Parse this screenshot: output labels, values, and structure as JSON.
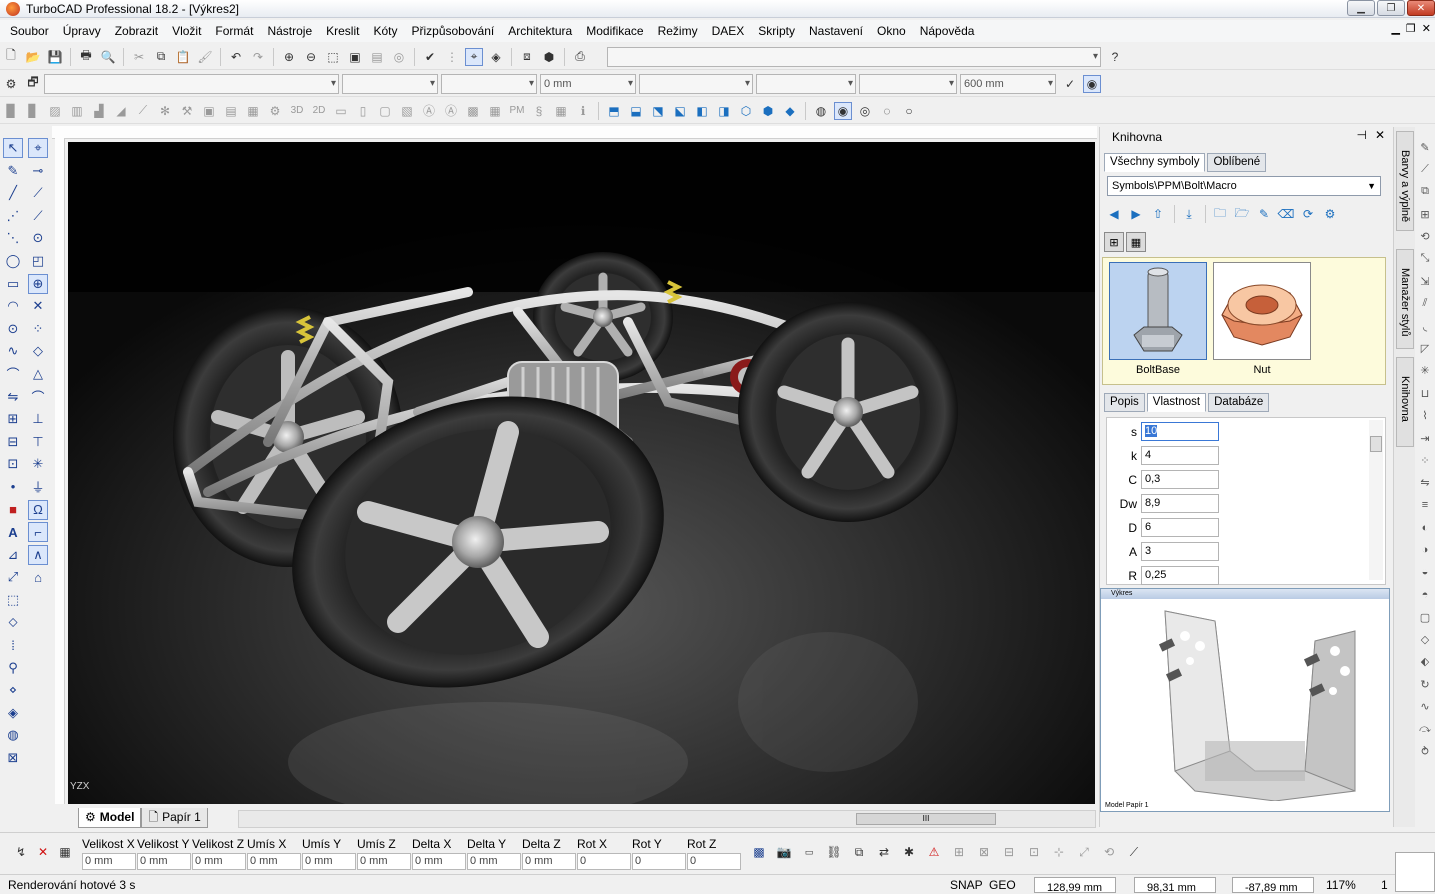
{
  "window": {
    "title": "TurboCAD Professional 18.2 - [Výkres2]"
  },
  "menu": [
    "Soubor",
    "Úpravy",
    "Zobrazit",
    "Vložit",
    "Formát",
    "Nástroje",
    "Kreslit",
    "Kóty",
    "Přizpůsobování",
    "Architektura",
    "Modifikace",
    "Režimy",
    "DAEX",
    "Skripty",
    "Nastavení",
    "Okno",
    "Nápověda"
  ],
  "toolbar2": {
    "width_value": "0 mm",
    "height_value": "600 mm"
  },
  "text3d": [
    "3D",
    "2D",
    "PM"
  ],
  "tabs": {
    "model": "Model",
    "paper": "Papír 1"
  },
  "inspector": {
    "fields": [
      {
        "label": "Velikost X",
        "value": "0 mm"
      },
      {
        "label": "Velikost Y",
        "value": "0 mm"
      },
      {
        "label": "Velikost Z",
        "value": "0 mm"
      },
      {
        "label": "Umís  X",
        "value": "0 mm"
      },
      {
        "label": "Umís Y",
        "value": "0 mm"
      },
      {
        "label": "Umís Z",
        "value": "0 mm"
      },
      {
        "label": "Delta X",
        "value": "0 mm"
      },
      {
        "label": "Delta Y",
        "value": "0 mm"
      },
      {
        "label": "Delta Z",
        "value": "0 mm"
      },
      {
        "label": "Rot X",
        "value": "0"
      },
      {
        "label": "Rot Y",
        "value": "0"
      },
      {
        "label": "Rot Z",
        "value": "0"
      }
    ]
  },
  "status": {
    "message": "Renderování hotové 3 s",
    "snap": "SNAP",
    "geo": "GEO",
    "x": "128,99 mm",
    "y": "98,31 mm",
    "z": "-87,89 mm",
    "zoom": "117%",
    "page": "1"
  },
  "library": {
    "title": "Knihovna",
    "tabs": [
      "Všechny symboly",
      "Oblíbené"
    ],
    "path": "Symbols\\PPM\\Bolt\\Macro",
    "items": [
      {
        "name": "BoltBase",
        "selected": true
      },
      {
        "name": "Nut",
        "selected": false
      }
    ],
    "prop_tabs": [
      "Popis",
      "Vlastnost",
      "Databáze"
    ],
    "properties": [
      {
        "key": "s",
        "value": "10"
      },
      {
        "key": "k",
        "value": "4"
      },
      {
        "key": "C",
        "value": "0,3"
      },
      {
        "key": "Dw",
        "value": "8,9"
      },
      {
        "key": "D",
        "value": "6"
      },
      {
        "key": "A",
        "value": "3"
      },
      {
        "key": "R",
        "value": "0,25"
      }
    ],
    "preview": {
      "window_title": "Výkres",
      "tabs": "Model  Papír 1"
    }
  },
  "side_tabs": [
    "Barvy a výplně",
    "Manažer stylů",
    "Knihovna"
  ],
  "canvas": {
    "axis_glyph": "YZX"
  }
}
